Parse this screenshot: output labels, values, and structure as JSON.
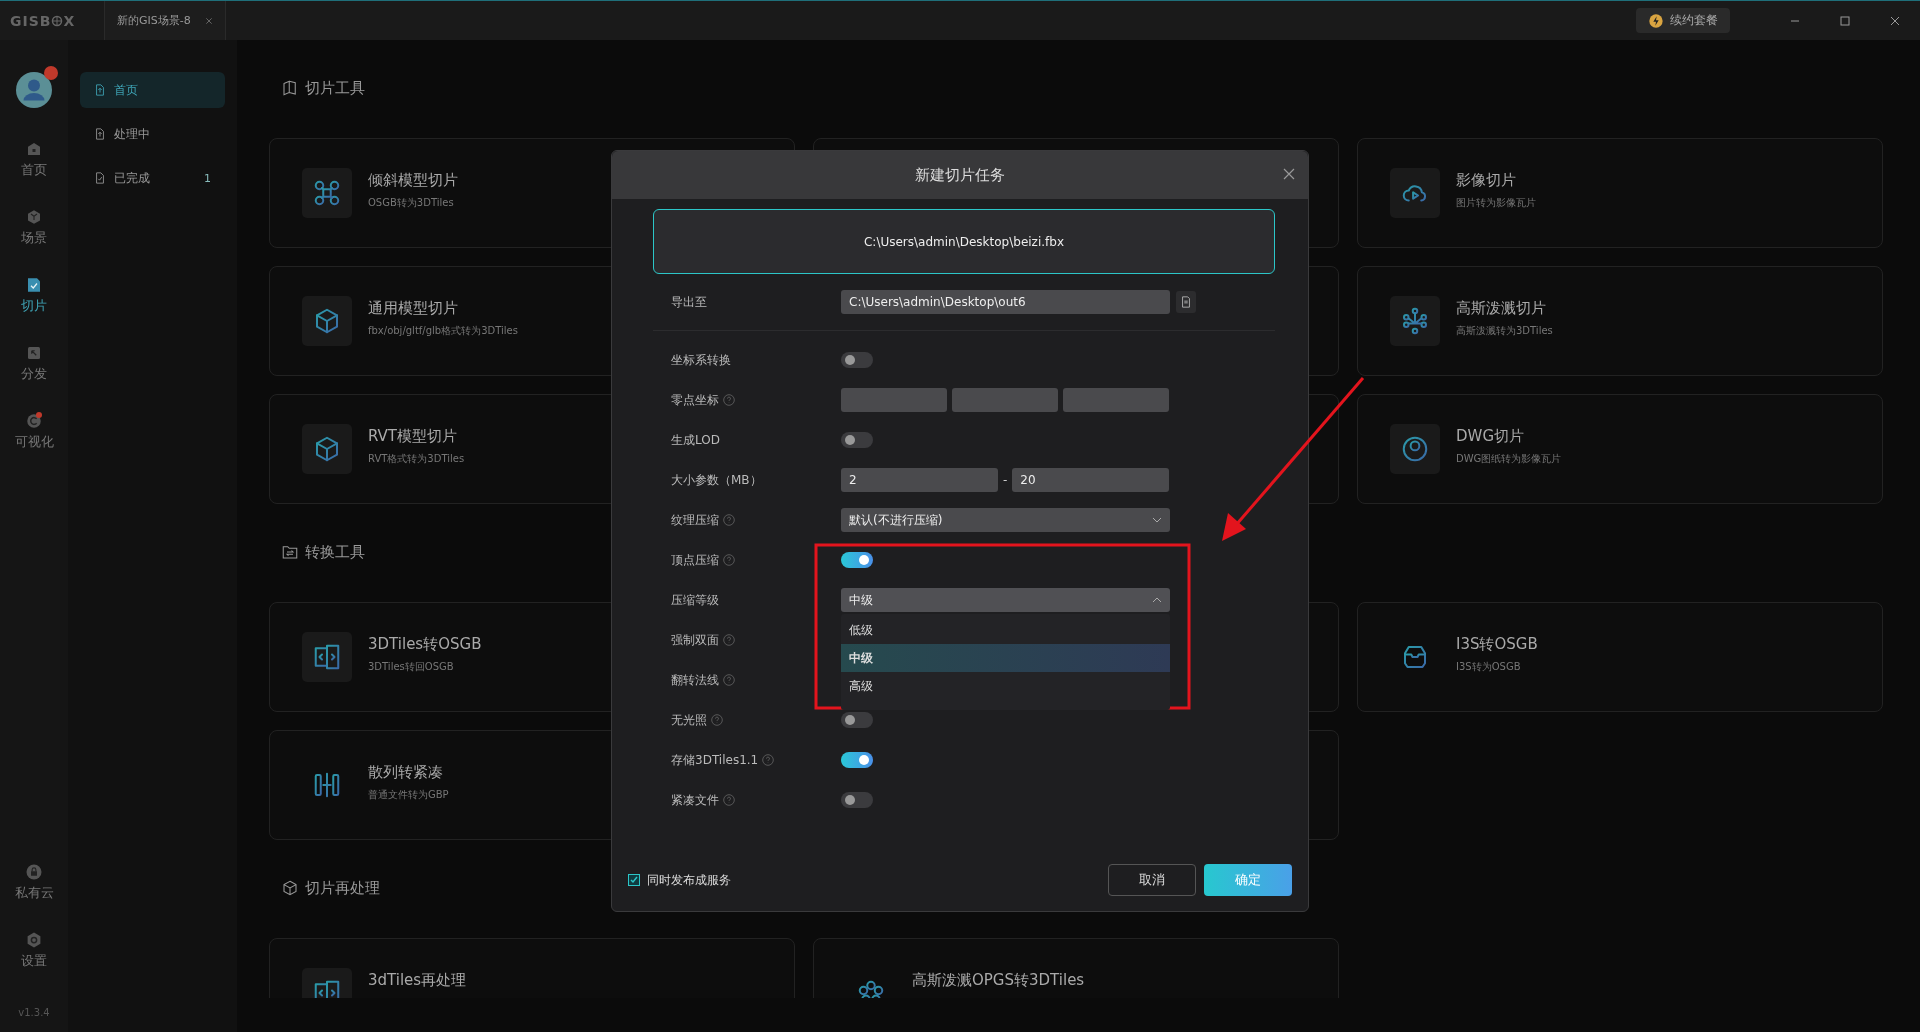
{
  "titlebar": {
    "logo_start": "GISB",
    "logo_end": "X",
    "tabs": [
      {
        "label": "新的GIS场景-8"
      }
    ],
    "plan_button": "续约套餐"
  },
  "rail": {
    "avatar": {
      "badge": true
    },
    "items": [
      {
        "label": "首页",
        "selected": false,
        "dot": false
      },
      {
        "label": "场景",
        "selected": false,
        "dot": false
      },
      {
        "label": "切片",
        "selected": true,
        "dot": false
      },
      {
        "label": "分发",
        "selected": false,
        "dot": false
      },
      {
        "label": "可视化",
        "selected": false,
        "dot": true
      }
    ],
    "bottom_items": [
      {
        "label": "私有云",
        "selected": false,
        "dot": false
      },
      {
        "label": "设置",
        "selected": false,
        "dot": false
      }
    ],
    "version": "v1.3.4"
  },
  "subnav": [
    {
      "label": "首页",
      "selected": true
    },
    {
      "label": "处理中",
      "selected": false
    },
    {
      "label": "已完成",
      "selected": false,
      "count": "1"
    }
  ],
  "sections": [
    {
      "title": "切片工具",
      "cards": [
        {
          "kind": "tool",
          "title": "倾斜模型切片",
          "subtitle": "OSGB转为3DTiles"
        },
        {
          "kind": "covered"
        },
        {
          "kind": "tool",
          "title": "影像切片",
          "subtitle": "图片转为影像瓦片"
        },
        {
          "kind": "tool",
          "title": "通用模型切片",
          "subtitle": "fbx/obj/gltf/glb格式转为3DTiles"
        },
        {
          "kind": "covered"
        },
        {
          "kind": "tool",
          "title": "高斯泼溅切片",
          "subtitle": "高斯泼溅转为3DTiles"
        },
        {
          "kind": "tool",
          "title": "RVT模型切片",
          "subtitle": "RVT格式转为3DTiles"
        },
        {
          "kind": "covered"
        },
        {
          "kind": "tool",
          "title": "DWG切片",
          "subtitle": "DWG图纸转为影像瓦片"
        }
      ]
    },
    {
      "title": "转换工具",
      "cards": [
        {
          "kind": "tool",
          "title": "3DTiles转OSGB",
          "subtitle": "3DTiles转回OSGB"
        },
        {
          "kind": "covered"
        },
        {
          "kind": "tool",
          "title": "I3S转OSGB",
          "subtitle": "I3S转为OSGB"
        },
        {
          "kind": "tool",
          "title": "散列转紧凑",
          "subtitle": "普通文件转为GBP"
        },
        {
          "kind": "covered"
        },
        {
          "kind": "empty"
        }
      ]
    },
    {
      "title": "切片再处理",
      "cards": [
        {
          "kind": "tool",
          "title": "3dTiles再处理"
        },
        {
          "kind": "tool",
          "title": "高斯泼溅OPGS转3DTiles"
        },
        {
          "kind": "empty"
        }
      ]
    }
  ],
  "dialog": {
    "title": "新建切片任务",
    "file": "C:\\Users\\admin\\Desktop\\beizi.fbx",
    "rows": [
      {
        "kind": "path",
        "label": "导出至",
        "help": false,
        "value": "C:\\Users\\admin\\Desktop\\out6"
      },
      {
        "kind": "toggle",
        "label": "坐标系转换",
        "help": false,
        "on": false
      },
      {
        "kind": "triple",
        "label": "零点坐标",
        "help": true
      },
      {
        "kind": "toggle",
        "label": "生成LOD",
        "help": false,
        "on": false
      },
      {
        "kind": "range",
        "label": "大小参数（MB）",
        "help": false,
        "min": "2",
        "separator": "-",
        "max": "20"
      },
      {
        "kind": "select",
        "label": "纹理压缩",
        "help": true,
        "value": "默认(不进行压缩)",
        "expanded": false
      },
      {
        "kind": "toggle",
        "label": "顶点压缩",
        "help": true,
        "on": true
      },
      {
        "kind": "select",
        "label": "压缩等级",
        "help": false,
        "value": "中级",
        "expanded": true,
        "options": [
          {
            "label": "低级",
            "selected": false
          },
          {
            "label": "中级",
            "selected": true
          },
          {
            "label": "高级",
            "selected": false
          }
        ]
      },
      {
        "kind": "label",
        "label": "强制双面",
        "help": true
      },
      {
        "kind": "label",
        "label": "翻转法线",
        "help": true
      },
      {
        "kind": "toggle",
        "label": "无光照",
        "help": true,
        "on": false
      },
      {
        "kind": "toggle",
        "label": "存储3DTiles1.1",
        "help": true,
        "on": true
      },
      {
        "kind": "toggle",
        "label": "紧凑文件",
        "help": true,
        "on": false
      }
    ],
    "publish": {
      "label": "同时发布成服务",
      "checked": true
    },
    "buttons": [
      {
        "label": "取消",
        "kind": "secondary"
      },
      {
        "label": "确定",
        "kind": "primary"
      }
    ]
  },
  "annotation": {
    "highlight_frame": true,
    "arrow": true
  }
}
